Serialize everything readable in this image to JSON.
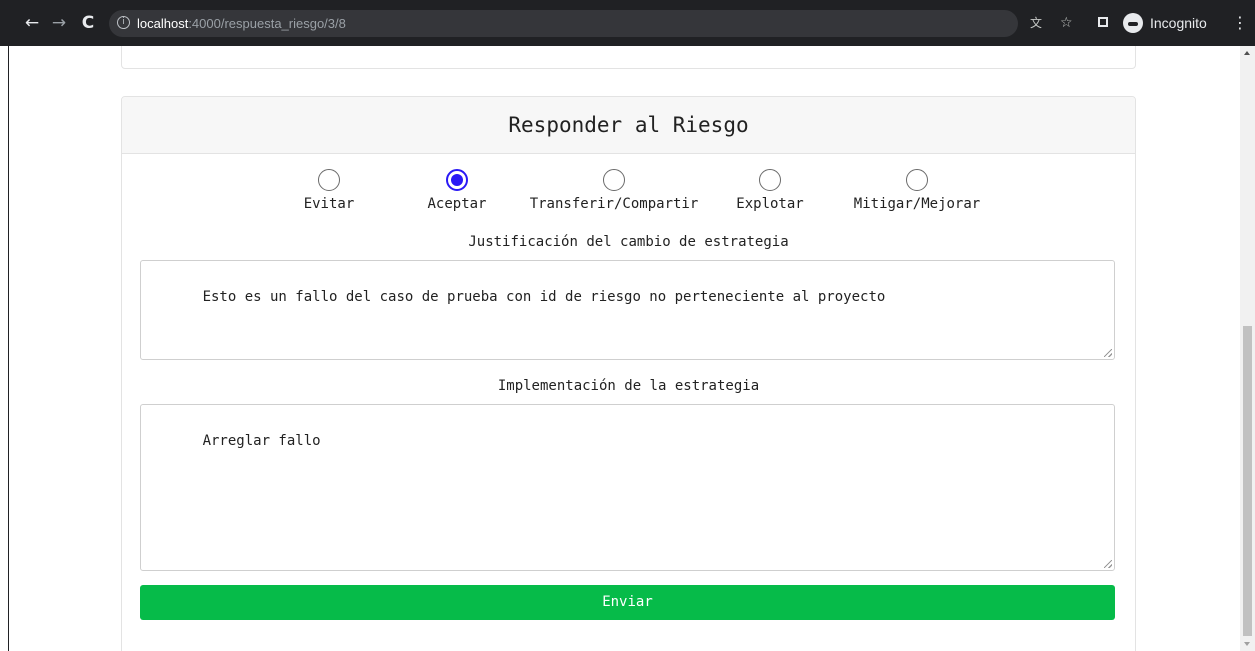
{
  "browser": {
    "url_host": "localhost",
    "url_path": ":4000/respuesta_riesgo/3/8",
    "incognito_label": "Incognito",
    "icons": [
      "back-icon",
      "forward-icon",
      "reload-icon",
      "info-icon",
      "translate-icon",
      "star-icon",
      "sidepanel-icon",
      "incognito-icon",
      "menu-icon"
    ]
  },
  "form": {
    "title": "Responder al Riesgo",
    "strategies": [
      {
        "label": "Evitar",
        "checked": false
      },
      {
        "label": "Aceptar",
        "checked": true
      },
      {
        "label": "Transferir/Compartir",
        "checked": false
      },
      {
        "label": "Explotar",
        "checked": false
      },
      {
        "label": "Mitigar/Mejorar",
        "checked": false
      }
    ],
    "justification_label": "Justificación del cambio de estrategia",
    "justification_value": "Esto es un fallo del caso de prueba con id de riesgo no perteneciente al proyecto",
    "implementation_label": "Implementación de la estrategia",
    "implementation_value": "Arreglar fallo",
    "submit_label": "Enviar",
    "accent_color": "#06bb49",
    "radio_color": "#2a19f5"
  }
}
